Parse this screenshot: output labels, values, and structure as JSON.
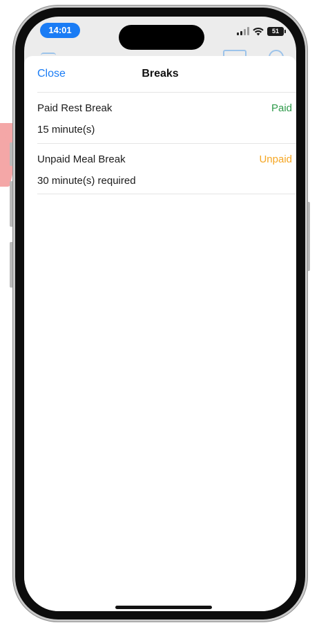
{
  "status_bar": {
    "time": "14:01",
    "battery": "51"
  },
  "sheet": {
    "close_label": "Close",
    "title": "Breaks"
  },
  "breaks": [
    {
      "name": "Paid Rest Break",
      "detail": "15 minute(s)",
      "status": "Paid",
      "status_color": "#2e9a4a"
    },
    {
      "name": "Unpaid Meal Break",
      "detail": "30 minute(s) required",
      "status": "Unpaid",
      "status_color": "#f5a623"
    }
  ],
  "colors": {
    "accent": "#1a7cf5",
    "paid": "#2e9a4a",
    "unpaid": "#f5a623"
  }
}
